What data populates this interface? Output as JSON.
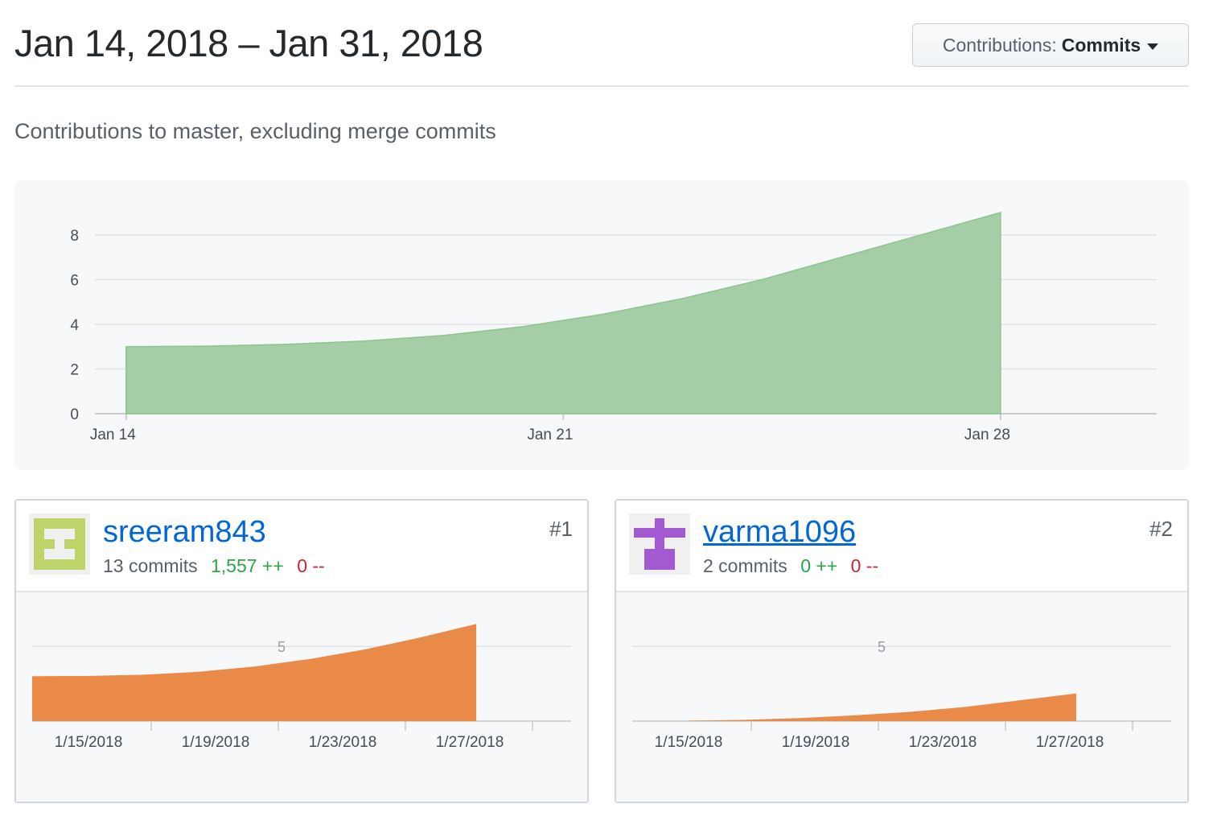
{
  "header": {
    "date_range": "Jan 14, 2018 – Jan 31, 2018",
    "select_prefix": "Contributions:",
    "select_value": "Commits"
  },
  "subtitle": "Contributions to master, excluding merge commits",
  "colors": {
    "main_area": "#a6cea6",
    "main_area_stroke": "#8ec48e",
    "contributor_area": "#ea8a48",
    "link": "#0366d6",
    "additions": "#28a745",
    "deletions": "#cb2431"
  },
  "chart_data": [
    {
      "type": "area",
      "y_ticks": [
        "0",
        "2",
        "4",
        "6",
        "8"
      ],
      "x_ticks": [
        "Jan 14",
        "Jan 21",
        "Jan 28"
      ],
      "x_tick_day_index": [
        0,
        7,
        14
      ],
      "x_range_day_index": [
        -0.5,
        16.5
      ],
      "ylim": [
        0,
        9
      ],
      "x_day_index": [
        0,
        14
      ],
      "y_curve": [
        3,
        3.02,
        3.1,
        3.25,
        3.5,
        3.9,
        4.45,
        5.15,
        6.0,
        7.0,
        8.0,
        9.0
      ],
      "grid": true
    },
    {
      "type": "area",
      "contributor": "sreeram843",
      "y_tick_labels": [
        "5"
      ],
      "y_tick_values": [
        5
      ],
      "ylim": [
        0,
        7
      ],
      "x_ticks": [
        "1/15/2018",
        "1/19/2018",
        "1/23/2018",
        "1/27/2018"
      ],
      "y_curve": [
        3,
        3.02,
        3.1,
        3.3,
        3.65,
        4.15,
        4.8,
        5.6,
        6.5
      ]
    },
    {
      "type": "area",
      "contributor": "varma1096",
      "y_tick_labels": [
        "5"
      ],
      "y_tick_values": [
        5
      ],
      "ylim": [
        0,
        7
      ],
      "x_ticks": [
        "1/15/2018",
        "1/19/2018",
        "1/23/2018",
        "1/27/2018"
      ],
      "y_curve": [
        0,
        0.02,
        0.08,
        0.2,
        0.38,
        0.62,
        0.95,
        1.4,
        1.85
      ]
    }
  ],
  "contributors": [
    {
      "username": "sreeram843",
      "commits": "13 commits",
      "additions": "1,557 ++",
      "deletions": "0 --",
      "rank": "#1"
    },
    {
      "username": "varma1096",
      "commits": "2 commits",
      "additions": "0 ++",
      "deletions": "0 --",
      "rank": "#2"
    }
  ]
}
